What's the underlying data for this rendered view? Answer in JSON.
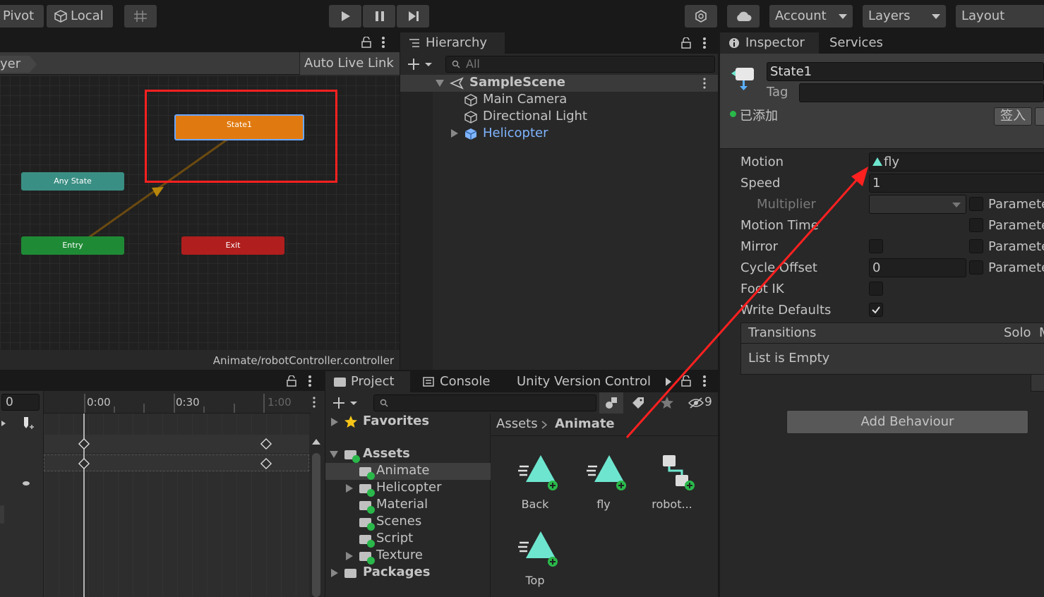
{
  "toolbar": {
    "pivot": "Pivot",
    "local": "Local",
    "account": "Account",
    "layers": "Layers",
    "layout": "Layout"
  },
  "animator": {
    "layer_tab": "yer",
    "auto_live_link": "Auto Live Link",
    "nodes": {
      "state1": "State1",
      "any_state": "Any State",
      "entry": "Entry",
      "exit": "Exit"
    },
    "footer_path": "Animate/robotController.controller"
  },
  "hierarchy": {
    "title": "Hierarchy",
    "search_placeholder": "All",
    "scene": "SampleScene",
    "items": [
      "Main Camera",
      "Directional Light",
      "Helicopter"
    ]
  },
  "inspector": {
    "tabs": [
      "Inspector",
      "Services"
    ],
    "name_value": "State1",
    "tag_label": "Tag",
    "added_label": "已添加",
    "sign_in": "签入",
    "rows": {
      "motion": "Motion",
      "motion_value": "fly",
      "speed": "Speed",
      "speed_value": "1",
      "multiplier": "Multiplier",
      "motion_time": "Motion Time",
      "mirror": "Mirror",
      "cycle_offset": "Cycle Offset",
      "cycle_offset_value": "0",
      "foot_ik": "Foot IK",
      "write_defaults": "Write Defaults",
      "parameter": "Paramete"
    },
    "transitions": "Transitions",
    "solo": "Solo",
    "mute_cut": "M",
    "list_empty": "List is Empty",
    "add_behaviour": "Add Behaviour"
  },
  "timeline": {
    "frame_value": "0",
    "ticks": [
      "0:00",
      "0:30",
      "1:00"
    ]
  },
  "project": {
    "tabs": [
      "Project",
      "Console",
      "Unity Version Control"
    ],
    "hidden_count": "9",
    "favorites": "Favorites",
    "tree": [
      "Assets",
      "Animate",
      "Helicopter",
      "Material",
      "Scenes",
      "Script",
      "Texture",
      "Packages"
    ],
    "breadcrumb": [
      "Assets",
      "Animate"
    ],
    "assets": [
      "Back",
      "fly",
      "robot...",
      "Top"
    ]
  },
  "colors": {
    "state_orange": "#e07a10",
    "any_state_teal": "#3a8f84",
    "entry_green": "#1f8a35",
    "exit_red": "#b01e1e",
    "annotation_red": "#ff2020",
    "link_blue": "#7fb4ff",
    "anim_icon": "#6ee6cf"
  }
}
